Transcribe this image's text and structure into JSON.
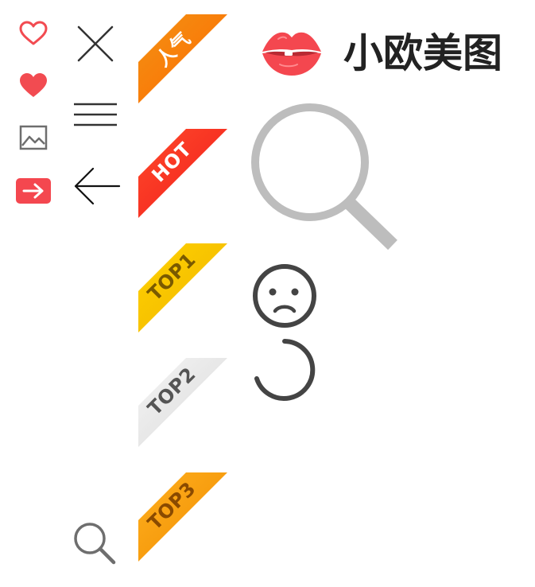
{
  "brand": {
    "title": "小欧美图",
    "lips_color": "#f4474f",
    "lips_dark": "#b82a33"
  },
  "colors": {
    "heart": "#f24b51",
    "icon_gray": "#6e6e6e",
    "line_dark": "#333333",
    "search_gray": "#bdbdbd",
    "face_dark": "#444444"
  },
  "left_icons": [
    "heart-outline-icon",
    "heart-filled-icon",
    "image-icon",
    "arrow-right-icon"
  ],
  "middle_icons": [
    "close-icon",
    "menu-icon",
    "arrow-left-icon",
    "search-icon"
  ],
  "right_icons": [
    "search-large-icon",
    "sad-face-icon",
    "loading-spinner-icon"
  ],
  "ribbons": [
    {
      "label": "人气",
      "color_from": "#f29214",
      "color_to": "#ff6a00",
      "text_color": "#ffffff"
    },
    {
      "label": "HOT",
      "color_from": "#ff4a2a",
      "color_to": "#f01c1c",
      "text_color": "#ffffff"
    },
    {
      "label": "TOP1",
      "color_from": "#ffd200",
      "color_to": "#f0b400",
      "text_color": "#7a5a00"
    },
    {
      "label": "TOP2",
      "color_from": "#f5f5f5",
      "color_to": "#d9d9d9",
      "text_color": "#555555"
    },
    {
      "label": "TOP3",
      "color_from": "#ffb01f",
      "color_to": "#f08c00",
      "text_color": "#8a4a00"
    }
  ]
}
